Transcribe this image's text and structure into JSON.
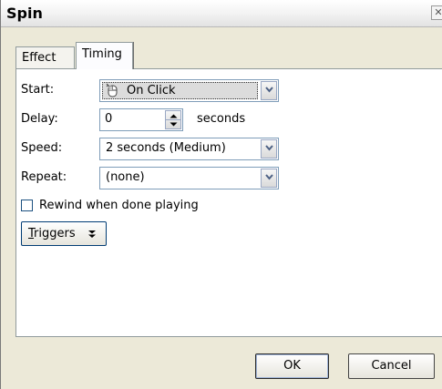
{
  "window": {
    "title": "Spin",
    "close_glyph": "✕"
  },
  "tabs": [
    {
      "label": "Effect",
      "active": false
    },
    {
      "label": "Timing",
      "active": true
    }
  ],
  "timing": {
    "start": {
      "label": "Start:",
      "value": "On Click",
      "icon": "mouse-icon"
    },
    "delay": {
      "label": "Delay:",
      "value": "0",
      "unit": "seconds"
    },
    "speed": {
      "label": "Speed:",
      "value": "2 seconds (Medium)"
    },
    "repeat": {
      "label": "Repeat:",
      "value": "(none)"
    },
    "rewind": {
      "label": "Rewind when done playing",
      "checked": false
    },
    "triggers": {
      "label": "Triggers",
      "icon": "double-chevron-down-icon"
    }
  },
  "footer": {
    "ok_label": "OK",
    "cancel_label": "Cancel"
  },
  "colors": {
    "dialog_bg": "#ece9d8",
    "field_border": "#7f9db9"
  }
}
